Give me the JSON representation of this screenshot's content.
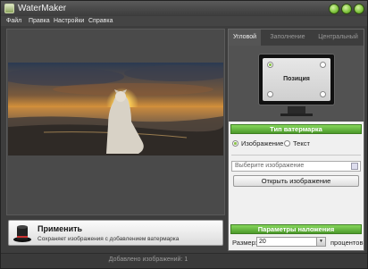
{
  "window": {
    "title": "WaterMaker"
  },
  "menu": [
    "Файл",
    "Правка",
    "Настройки",
    "Справка"
  ],
  "tabs": [
    "Угловой",
    "Заполнение",
    "Центральный"
  ],
  "position": {
    "label": "Позиция",
    "selected": "top-left"
  },
  "watermark_type": {
    "header": "Тип ватермарка",
    "options": [
      "Изображение",
      "Текст"
    ],
    "selected": "Изображение"
  },
  "image_input": {
    "placeholder": "Выберите изображение"
  },
  "open_button": {
    "label": "Открыть изображение"
  },
  "overlay": {
    "header": "Параметры наложения",
    "size_label": "Размер:",
    "size_value": "20",
    "size_unit": "процентов"
  },
  "apply": {
    "title": "Применить",
    "subtitle": "Сохраняет изображения с добавлением ватермарка"
  },
  "status": {
    "text": "Добавлено изображений: 1"
  },
  "colors": {
    "accent": "#6bbf3f",
    "background": "#3d3d3d"
  }
}
